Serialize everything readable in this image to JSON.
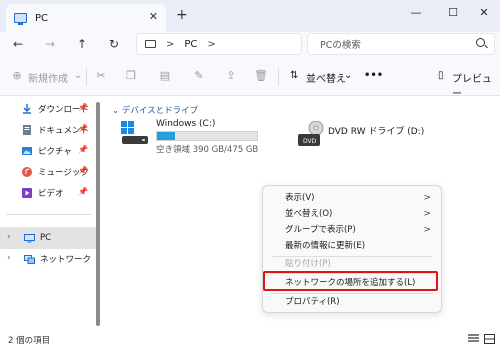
{
  "window": {
    "tab_title": "PC",
    "tab_close": "✕",
    "new_tab": "+",
    "minimize": "—",
    "maximize": "☐",
    "close": "✕"
  },
  "address": {
    "separator": ">",
    "location": "PC",
    "chevron": ">",
    "search_placeholder": "PCの検索"
  },
  "toolbar": {
    "new_label": "新規作成",
    "sort_label": "並べ替え",
    "more": "•••",
    "preview_label": "プレビュー"
  },
  "sidebar": {
    "quick_access": [
      {
        "label": "ダウンロード"
      },
      {
        "label": "ドキュメント"
      },
      {
        "label": "ピクチャ"
      },
      {
        "label": "ミュージック"
      },
      {
        "label": "ビデオ"
      }
    ],
    "tree": [
      {
        "label": "PC"
      },
      {
        "label": "ネットワーク"
      }
    ]
  },
  "main": {
    "group_header": "デバイスとドライブ",
    "drives": [
      {
        "name": "Windows (C:)",
        "free_text": "空き領域 390 GB/475 GB",
        "used_fraction": 0.18
      },
      {
        "name": "DVD RW ドライブ (D:)",
        "badge": "DVD"
      }
    ]
  },
  "context_menu": {
    "items": [
      {
        "label": "表示(V)",
        "submenu": ">"
      },
      {
        "label": "並べ替え(O)",
        "submenu": ">"
      },
      {
        "label": "グループで表示(P)",
        "submenu": ">"
      },
      {
        "label": "最新の情報に更新(E)"
      },
      {
        "label": "貼り付け(P)"
      },
      {
        "label": "ネットワークの場所を追加する(L)"
      },
      {
        "label": "プロパティ(R)"
      }
    ]
  },
  "status": {
    "item_count": "2 個の項目"
  },
  "colors": {
    "accent": "#1e6fd1",
    "highlight_box": "#e11414",
    "storage_fill": "#26a0da"
  }
}
